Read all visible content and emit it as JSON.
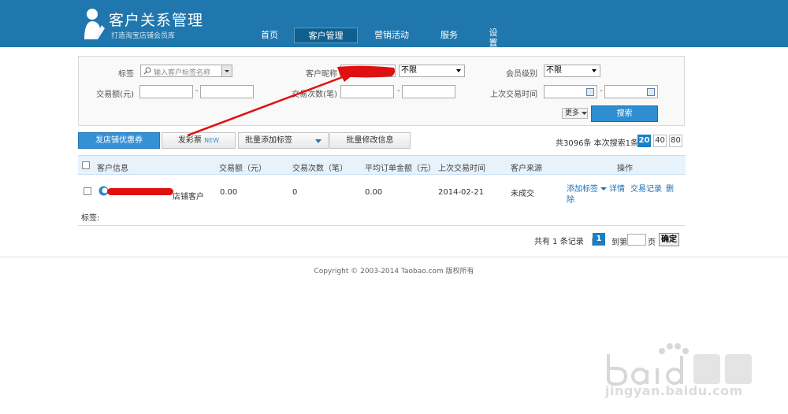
{
  "header": {
    "title": "客户关系管理",
    "subtitle": "打造淘宝店铺会员库",
    "nav": [
      {
        "label": "首页",
        "active": false
      },
      {
        "label": "客户管理",
        "active": true
      },
      {
        "label": "营销活动",
        "active": false
      },
      {
        "label": "服务",
        "active": false
      },
      {
        "label": "设置",
        "active": false
      }
    ]
  },
  "filters": {
    "tag_label": "标签",
    "tag_placeholder": "输入客户标签名称",
    "nickname_label": "客户昵称",
    "nickname_scope": "不限",
    "member_level_label": "会员级别",
    "member_level_value": "不限",
    "amount_label": "交易额(元)",
    "count_label": "交易次数(笔)",
    "last_trade_label": "上次交易时间",
    "dash": "-",
    "more_label": "更多",
    "search_label": "搜索"
  },
  "actions": {
    "coupon_label": "发店铺优惠券",
    "lottery_label": "发彩票",
    "lottery_badge": "NEW",
    "batch_tag_label": "批量添加标签",
    "batch_edit_label": "批量修改信息",
    "total_text": "共3096条 本次搜索1条",
    "page_sizes": [
      "20",
      "40",
      "80"
    ]
  },
  "table": {
    "columns": [
      "客户信息",
      "交易额（元）",
      "交易次数（笔）",
      "平均订单金额（元）",
      "上次交易时间",
      "客户来源",
      "操作"
    ],
    "rows": [
      {
        "customer_suffix": "店铺客户",
        "amount": "0.00",
        "count": "0",
        "avg": "0.00",
        "last_trade": "2014-02-21",
        "source": "未成交",
        "ops": {
          "add_tag": "添加标签",
          "detail": "详情",
          "records": "交易记录",
          "del_1": "删",
          "del_2": "除"
        }
      }
    ],
    "tag_label": "标签:"
  },
  "pagination": {
    "info": "共有 1 条记录",
    "sep": "|",
    "current": "1",
    "goto_label": "到第",
    "page_unit": "页",
    "confirm": "确定"
  },
  "footer": {
    "copyright": "Copyright © 2003-2014 Taobao.com 版权所有"
  },
  "watermark": {
    "url": "jingyan.baidu.com"
  },
  "colors": {
    "header_bg": "#1f77ad",
    "accent_blue": "#2e8ed1",
    "annotation_red": "#e01010"
  }
}
